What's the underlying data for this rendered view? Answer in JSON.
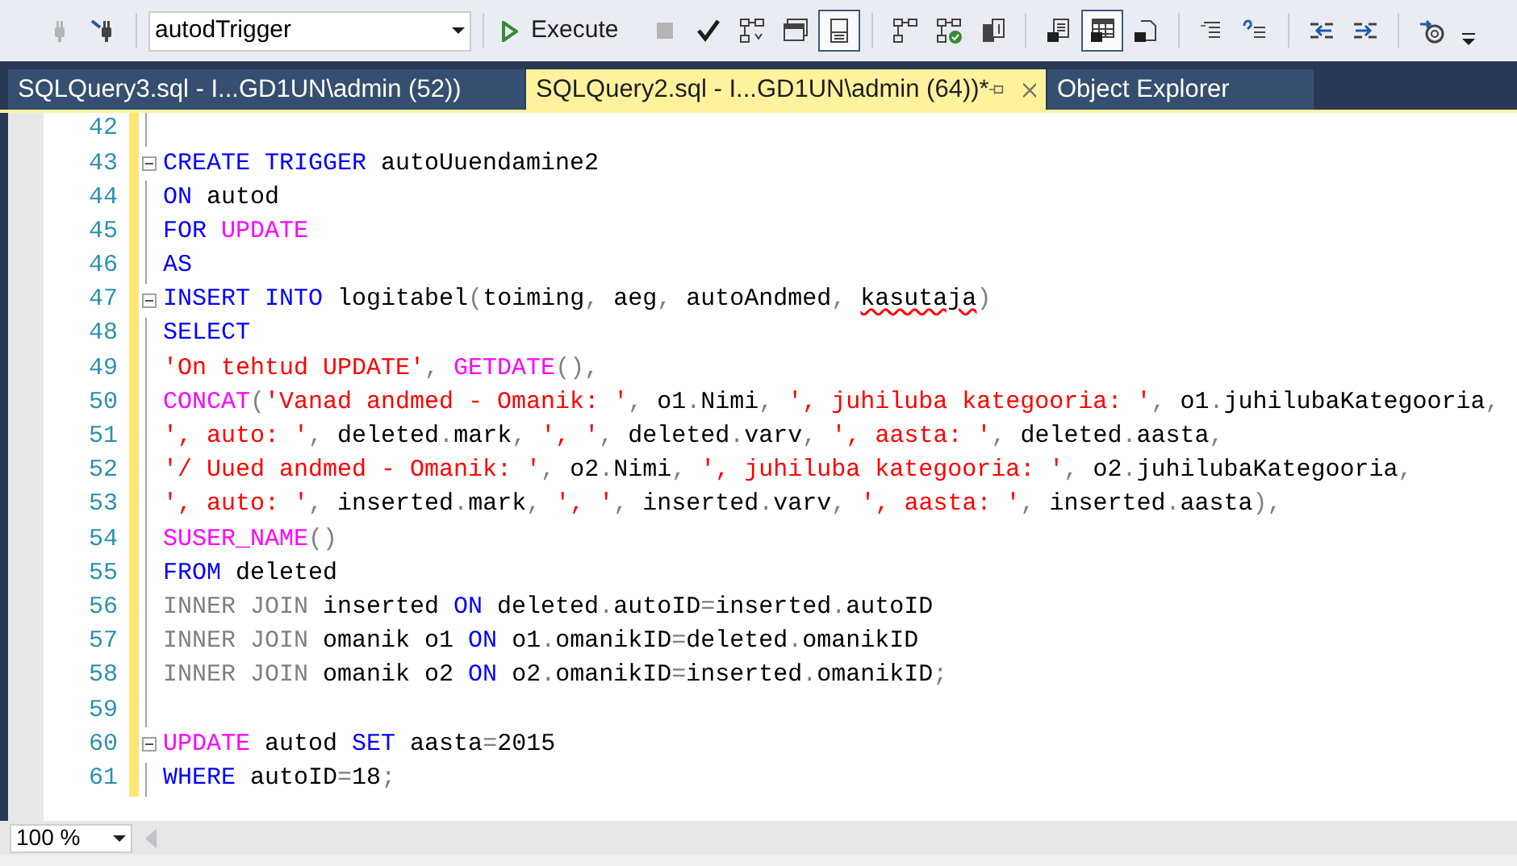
{
  "toolbar": {
    "database": "autodTrigger",
    "execute": {
      "label": "Execute"
    },
    "buttons": [
      {
        "disabled": true,
        "selected": false
      },
      {
        "disabled": false,
        "selected": false
      },
      {
        "disabled": true,
        "selected": false
      },
      {
        "disabled": false,
        "selected": false
      },
      {
        "disabled": false,
        "selected": false
      },
      {
        "disabled": false,
        "selected": false
      },
      {
        "disabled": false,
        "selected": true
      },
      {
        "disabled": false,
        "selected": false
      },
      {
        "disabled": false,
        "selected": false
      },
      {
        "disabled": false,
        "selected": false
      },
      {
        "disabled": false,
        "selected": false
      },
      {
        "disabled": false,
        "selected": true
      },
      {
        "disabled": false,
        "selected": false
      },
      {
        "disabled": false,
        "selected": false
      },
      {
        "disabled": false,
        "selected": false
      },
      {
        "disabled": false,
        "selected": false
      },
      {
        "disabled": false,
        "selected": false
      },
      {
        "disabled": false,
        "selected": false
      }
    ]
  },
  "tabs": [
    {
      "label": "SQLQuery3.sql - I...GD1UN\\admin (52))",
      "selected": false
    },
    {
      "label": "SQLQuery2.sql - I...GD1UN\\admin (64))*",
      "selected": true
    },
    {
      "label": "Object Explorer",
      "selected": false
    }
  ],
  "editor": {
    "lines": [
      {
        "number": "42",
        "modified": true,
        "fold": false
      },
      {
        "number": "43",
        "modified": true,
        "fold": true,
        "code": [
          {
            "kind": "keyword",
            "text": "CREATE TRIGGER"
          },
          {
            "kind": "text",
            "text": " autoUuendamine2"
          }
        ]
      },
      {
        "number": "44",
        "modified": true,
        "fold": false,
        "code": [
          {
            "kind": "keyword",
            "text": "ON"
          },
          {
            "kind": "text",
            "text": " autod"
          }
        ]
      },
      {
        "number": "45",
        "modified": true,
        "fold": false,
        "code": [
          {
            "kind": "keyword",
            "text": "FOR "
          },
          {
            "kind": "function",
            "text": "UPDATE"
          }
        ]
      },
      {
        "number": "46",
        "modified": true,
        "fold": false,
        "code": [
          {
            "kind": "keyword",
            "text": "AS"
          }
        ]
      },
      {
        "number": "47",
        "modified": true,
        "fold": true,
        "code": [
          {
            "kind": "keyword",
            "text": "INSERT INTO"
          },
          {
            "kind": "text",
            "text": " logitabel"
          },
          {
            "kind": "punct",
            "text": "("
          },
          {
            "kind": "text",
            "text": "toiming"
          },
          {
            "kind": "punct",
            "text": ","
          },
          {
            "kind": "text",
            "text": " aeg"
          },
          {
            "kind": "punct",
            "text": ","
          },
          {
            "kind": "text",
            "text": " autoAndmed"
          },
          {
            "kind": "punct",
            "text": ", "
          },
          {
            "kind": "error",
            "text": "kasutaja"
          },
          {
            "kind": "punct",
            "text": ")"
          }
        ]
      },
      {
        "number": "48",
        "modified": true,
        "fold": false,
        "code": [
          {
            "kind": "keyword",
            "text": "SELECT"
          }
        ]
      },
      {
        "number": "49",
        "modified": true,
        "fold": false,
        "code": [
          {
            "kind": "string",
            "text": "'On tehtud UPDATE'"
          },
          {
            "kind": "punct",
            "text": ", "
          },
          {
            "kind": "function",
            "text": "GETDATE"
          },
          {
            "kind": "punct",
            "text": "(),"
          }
        ]
      },
      {
        "number": "50",
        "modified": true,
        "fold": false,
        "code": [
          {
            "kind": "function",
            "text": "CONCAT"
          },
          {
            "kind": "punct",
            "text": "("
          },
          {
            "kind": "string",
            "text": "'Vanad andmed - Omanik: '"
          },
          {
            "kind": "punct",
            "text": ","
          },
          {
            "kind": "text",
            "text": " o1"
          },
          {
            "kind": "punct",
            "text": "."
          },
          {
            "kind": "text",
            "text": "Nimi"
          },
          {
            "kind": "punct",
            "text": ", "
          },
          {
            "kind": "string",
            "text": "', juhiluba kategooria: '"
          },
          {
            "kind": "punct",
            "text": ","
          },
          {
            "kind": "text",
            "text": " o1"
          },
          {
            "kind": "punct",
            "text": "."
          },
          {
            "kind": "text",
            "text": "juhilubaKategooria"
          },
          {
            "kind": "punct",
            "text": ","
          }
        ]
      },
      {
        "number": "51",
        "modified": true,
        "fold": false,
        "code": [
          {
            "kind": "string",
            "text": "', auto: '"
          },
          {
            "kind": "punct",
            "text": ","
          },
          {
            "kind": "text",
            "text": " deleted"
          },
          {
            "kind": "punct",
            "text": "."
          },
          {
            "kind": "text",
            "text": "mark"
          },
          {
            "kind": "punct",
            "text": ", "
          },
          {
            "kind": "string",
            "text": "', '"
          },
          {
            "kind": "punct",
            "text": ","
          },
          {
            "kind": "text",
            "text": " deleted"
          },
          {
            "kind": "punct",
            "text": "."
          },
          {
            "kind": "text",
            "text": "varv"
          },
          {
            "kind": "punct",
            "text": ", "
          },
          {
            "kind": "string",
            "text": "', aasta: '"
          },
          {
            "kind": "punct",
            "text": ","
          },
          {
            "kind": "text",
            "text": " deleted"
          },
          {
            "kind": "punct",
            "text": "."
          },
          {
            "kind": "text",
            "text": "aasta"
          },
          {
            "kind": "punct",
            "text": ","
          }
        ]
      },
      {
        "number": "52",
        "modified": true,
        "fold": false,
        "code": [
          {
            "kind": "string",
            "text": "'/ Uued andmed - Omanik: '"
          },
          {
            "kind": "punct",
            "text": ","
          },
          {
            "kind": "text",
            "text": " o2"
          },
          {
            "kind": "punct",
            "text": "."
          },
          {
            "kind": "text",
            "text": "Nimi"
          },
          {
            "kind": "punct",
            "text": ", "
          },
          {
            "kind": "string",
            "text": "', juhiluba kategooria: '"
          },
          {
            "kind": "punct",
            "text": ","
          },
          {
            "kind": "text",
            "text": " o2"
          },
          {
            "kind": "punct",
            "text": "."
          },
          {
            "kind": "text",
            "text": "juhilubaKategooria"
          },
          {
            "kind": "punct",
            "text": ","
          }
        ]
      },
      {
        "number": "53",
        "modified": true,
        "fold": false,
        "code": [
          {
            "kind": "string",
            "text": "', auto: '"
          },
          {
            "kind": "punct",
            "text": ","
          },
          {
            "kind": "text",
            "text": " inserted"
          },
          {
            "kind": "punct",
            "text": "."
          },
          {
            "kind": "text",
            "text": "mark"
          },
          {
            "kind": "punct",
            "text": ", "
          },
          {
            "kind": "string",
            "text": "', '"
          },
          {
            "kind": "punct",
            "text": ","
          },
          {
            "kind": "text",
            "text": " inserted"
          },
          {
            "kind": "punct",
            "text": "."
          },
          {
            "kind": "text",
            "text": "varv"
          },
          {
            "kind": "punct",
            "text": ", "
          },
          {
            "kind": "string",
            "text": "', aasta: '"
          },
          {
            "kind": "punct",
            "text": ","
          },
          {
            "kind": "text",
            "text": " inserted"
          },
          {
            "kind": "punct",
            "text": "."
          },
          {
            "kind": "text",
            "text": "aasta"
          },
          {
            "kind": "punct",
            "text": "),"
          }
        ]
      },
      {
        "number": "54",
        "modified": true,
        "fold": false,
        "code": [
          {
            "kind": "function",
            "text": "SUSER_NAME"
          },
          {
            "kind": "punct",
            "text": "()"
          }
        ]
      },
      {
        "number": "55",
        "modified": true,
        "fold": false,
        "code": [
          {
            "kind": "keyword",
            "text": "FROM"
          },
          {
            "kind": "text",
            "text": " deleted"
          }
        ]
      },
      {
        "number": "56",
        "modified": true,
        "fold": false,
        "code": [
          {
            "kind": "punct",
            "text": "INNER JOIN"
          },
          {
            "kind": "text",
            "text": " inserted "
          },
          {
            "kind": "keyword",
            "text": "ON"
          },
          {
            "kind": "text",
            "text": " deleted"
          },
          {
            "kind": "punct",
            "text": "."
          },
          {
            "kind": "text",
            "text": "autoID"
          },
          {
            "kind": "punct",
            "text": "="
          },
          {
            "kind": "text",
            "text": "inserted"
          },
          {
            "kind": "punct",
            "text": "."
          },
          {
            "kind": "text",
            "text": "autoID"
          }
        ]
      },
      {
        "number": "57",
        "modified": true,
        "fold": false,
        "code": [
          {
            "kind": "punct",
            "text": "INNER JOIN"
          },
          {
            "kind": "text",
            "text": " omanik o1 "
          },
          {
            "kind": "keyword",
            "text": "ON"
          },
          {
            "kind": "text",
            "text": " o1"
          },
          {
            "kind": "punct",
            "text": "."
          },
          {
            "kind": "text",
            "text": "omanikID"
          },
          {
            "kind": "punct",
            "text": "="
          },
          {
            "kind": "text",
            "text": "deleted"
          },
          {
            "kind": "punct",
            "text": "."
          },
          {
            "kind": "text",
            "text": "omanikID"
          }
        ]
      },
      {
        "number": "58",
        "modified": true,
        "fold": false,
        "code": [
          {
            "kind": "punct",
            "text": "INNER JOIN"
          },
          {
            "kind": "text",
            "text": " omanik o2 "
          },
          {
            "kind": "keyword",
            "text": "ON"
          },
          {
            "kind": "text",
            "text": " o2"
          },
          {
            "kind": "punct",
            "text": "."
          },
          {
            "kind": "text",
            "text": "omanikID"
          },
          {
            "kind": "punct",
            "text": "="
          },
          {
            "kind": "text",
            "text": "inserted"
          },
          {
            "kind": "punct",
            "text": "."
          },
          {
            "kind": "text",
            "text": "omanikID"
          },
          {
            "kind": "punct",
            "text": ";"
          }
        ]
      },
      {
        "number": "59",
        "modified": true,
        "fold": false
      },
      {
        "number": "60",
        "modified": true,
        "fold": true,
        "code": [
          {
            "kind": "function",
            "text": "UPDATE"
          },
          {
            "kind": "text",
            "text": " autod "
          },
          {
            "kind": "keyword",
            "text": "SET"
          },
          {
            "kind": "text",
            "text": " aasta"
          },
          {
            "kind": "punct",
            "text": "="
          },
          {
            "kind": "text",
            "text": "2015"
          }
        ]
      },
      {
        "number": "61",
        "modified": true,
        "fold": false,
        "code": [
          {
            "kind": "keyword",
            "text": "WHERE"
          },
          {
            "kind": "text",
            "text": " autoID"
          },
          {
            "kind": "punct",
            "text": "="
          },
          {
            "kind": "text",
            "text": "18"
          },
          {
            "kind": "punct",
            "text": ";"
          }
        ]
      }
    ]
  },
  "status": {
    "zoom": "100 %"
  }
}
